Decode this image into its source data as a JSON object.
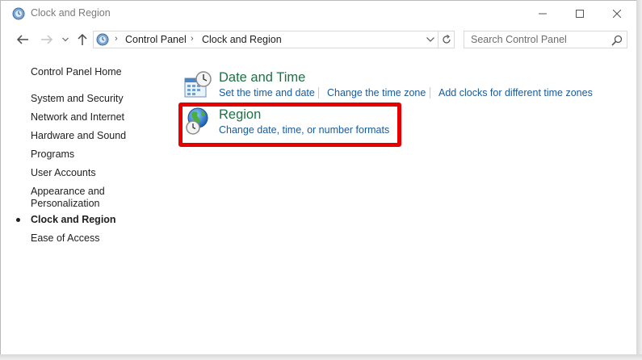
{
  "window": {
    "title": "Clock and Region",
    "controls": {
      "minimize_icon": "minimize-icon",
      "maximize_icon": "maximize-icon",
      "close_icon": "close-icon"
    }
  },
  "address": {
    "breadcrumbs": [
      "Control Panel",
      "Clock and Region"
    ],
    "search_placeholder": "Search Control Panel"
  },
  "sidebar": {
    "home": "Control Panel Home",
    "items": [
      {
        "label": "System and Security"
      },
      {
        "label": "Network and Internet"
      },
      {
        "label": "Hardware and Sound"
      },
      {
        "label": "Programs"
      },
      {
        "label": "User Accounts"
      },
      {
        "label": "Appearance and"
      },
      {
        "label": "Personalization"
      },
      {
        "label": "Clock and Region",
        "current": true
      },
      {
        "label": "Ease of Access"
      }
    ]
  },
  "categories": [
    {
      "title": "Date and Time",
      "icon": "calendar-clock-icon",
      "links": [
        "Set the time and date",
        "Change the time zone",
        "Add clocks for different time zones"
      ]
    },
    {
      "title": "Region",
      "icon": "globe-clock-icon",
      "links": [
        "Change date, time, or number formats"
      ],
      "highlighted": true
    }
  ],
  "colors": {
    "category_title": "#1e7145",
    "link": "#1a5a9a",
    "highlight": "#e60000"
  }
}
